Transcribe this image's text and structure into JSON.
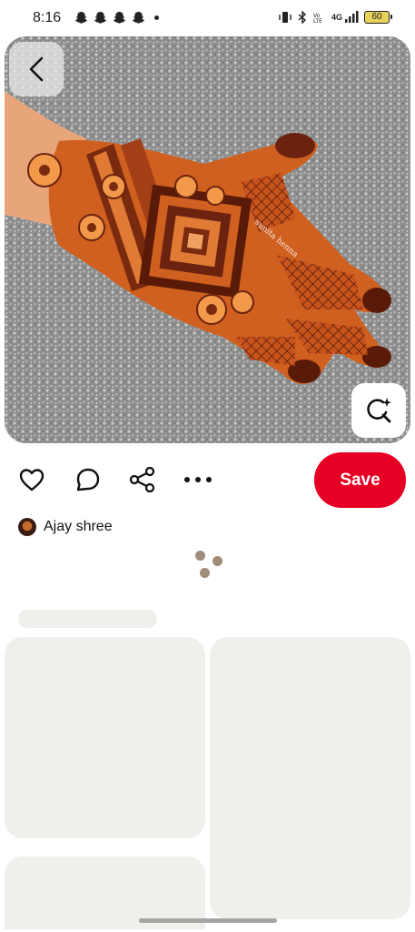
{
  "status_bar": {
    "time": "8:16",
    "network_label": "4G",
    "battery_level": "60"
  },
  "pin": {
    "image_alt": "Orange henna mehndi design on the back of a hand",
    "watermark": "sunita henna"
  },
  "actions": {
    "save_label": "Save"
  },
  "author": {
    "name": "Ajay shree"
  },
  "colors": {
    "save_red": "#e60023",
    "skeleton": "#efefeb",
    "loader_dot": "#a08c78"
  }
}
